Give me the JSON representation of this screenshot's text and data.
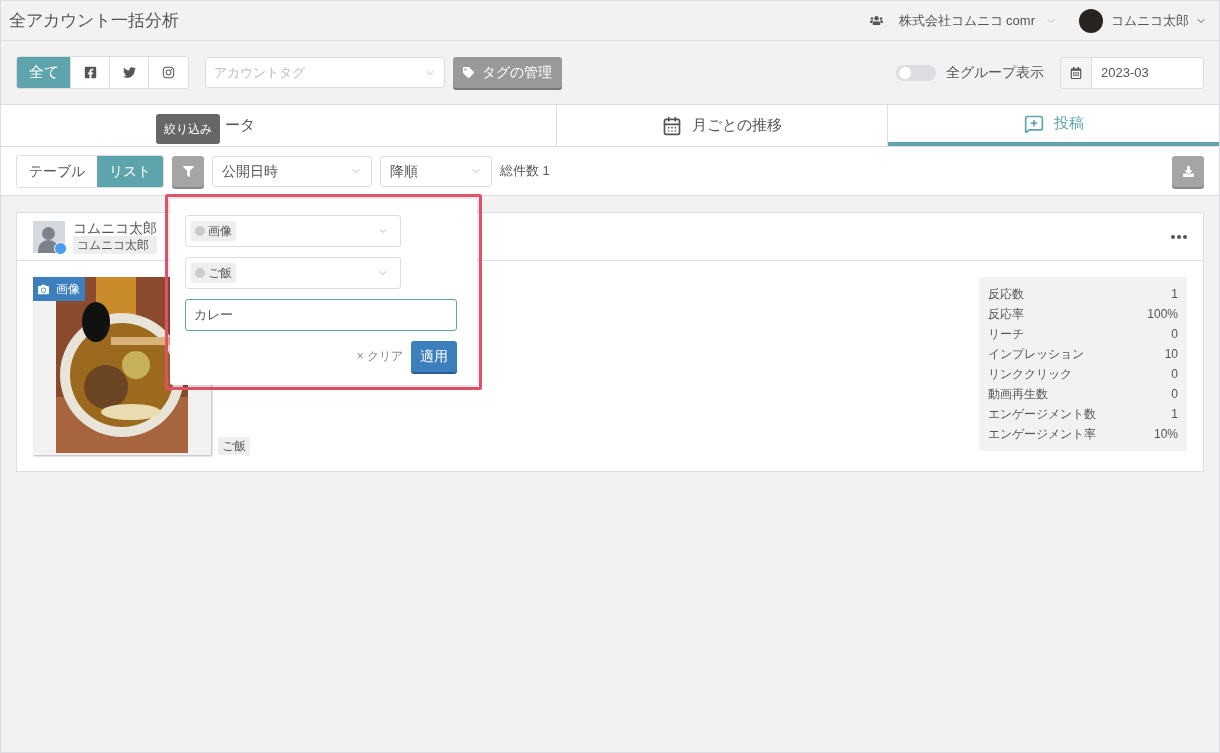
{
  "header": {
    "title": "全アカウント一括分析",
    "company": "株式会社コムニコ comr",
    "user": "コムニコ太郎"
  },
  "toolbar": {
    "networks": [
      {
        "kind": "text",
        "label": "全て",
        "selected": true
      },
      {
        "kind": "facebook",
        "selected": false
      },
      {
        "kind": "twitter",
        "selected": false
      },
      {
        "kind": "instagram",
        "selected": false
      }
    ],
    "account_tag": {
      "placeholder": "アカウントタグ"
    },
    "manage_tags": "タグの管理",
    "all_groups": {
      "label": "全グループ表示",
      "on": false
    },
    "month": "2023-03"
  },
  "tabs": [
    {
      "kind": "data",
      "label": "ータ",
      "selected": false
    },
    {
      "kind": "calendar",
      "label": "月ごとの推移",
      "selected": false
    },
    {
      "kind": "post",
      "label": "投稿",
      "selected": true
    }
  ],
  "list_bar": {
    "views": [
      {
        "label": "テーブル",
        "selected": false
      },
      {
        "label": "リスト",
        "selected": true
      }
    ],
    "tooltip": "絞り込み",
    "sort_field": "公開日時",
    "sort_order": "降順",
    "total": "総件数 1"
  },
  "filter_popover": {
    "selects": [
      {
        "chip": "画像"
      },
      {
        "chip": "ご飯"
      }
    ],
    "keyword": "カレー",
    "clear": "× クリア",
    "apply": "適用"
  },
  "post": {
    "author": "コムニコ太郎",
    "account_tag": "コムニコ太郎",
    "media_badge": "画像",
    "tag": "ご飯",
    "stats": [
      {
        "label": "反応数",
        "value": "1"
      },
      {
        "label": "反応率",
        "value": "100%"
      },
      {
        "label": "リーチ",
        "value": "0"
      },
      {
        "label": "インプレッション",
        "value": "10"
      },
      {
        "label": "リンククリック",
        "value": "0"
      },
      {
        "label": "動画再生数",
        "value": "0"
      },
      {
        "label": "エンゲージメント数",
        "value": "1"
      },
      {
        "label": "エンゲージメント率",
        "value": "10%"
      }
    ]
  }
}
